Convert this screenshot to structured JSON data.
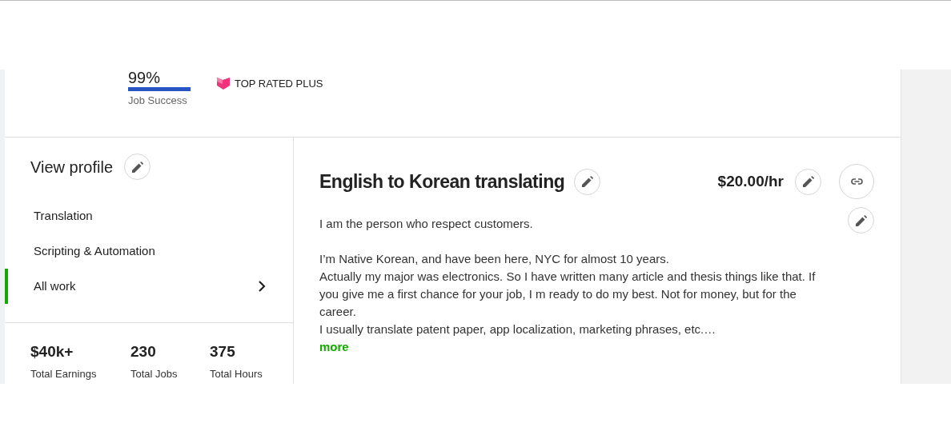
{
  "job_success": {
    "value": "99%",
    "label": "Job Success",
    "level": 0.99
  },
  "badge": {
    "label": "TOP RATED PLUS"
  },
  "sidebar": {
    "title": "View profile",
    "items": [
      {
        "label": "Translation",
        "selected": false
      },
      {
        "label": "Scripting & Automation",
        "selected": false
      },
      {
        "label": "All work",
        "selected": true
      }
    ]
  },
  "stats": [
    {
      "value": "$40k+",
      "label": "Total Earnings"
    },
    {
      "value": "230",
      "label": "Total Jobs"
    },
    {
      "value": "375",
      "label": "Total Hours"
    }
  ],
  "profile": {
    "title": "English to Korean translating",
    "rate": "$20.00/hr",
    "paragraphs": [
      "I am the person who respect customers.",
      "I’m Native Korean, and have been here, NYC for almost 10 years.",
      "Actually my major was electronics. So I have written many article and thesis things like that. If you give me a first chance for your job, I m ready to do my best. Not for money, but for the career.",
      "I usually translate patent paper, app localization, marketing phrases, etc.…"
    ],
    "more": "more"
  }
}
